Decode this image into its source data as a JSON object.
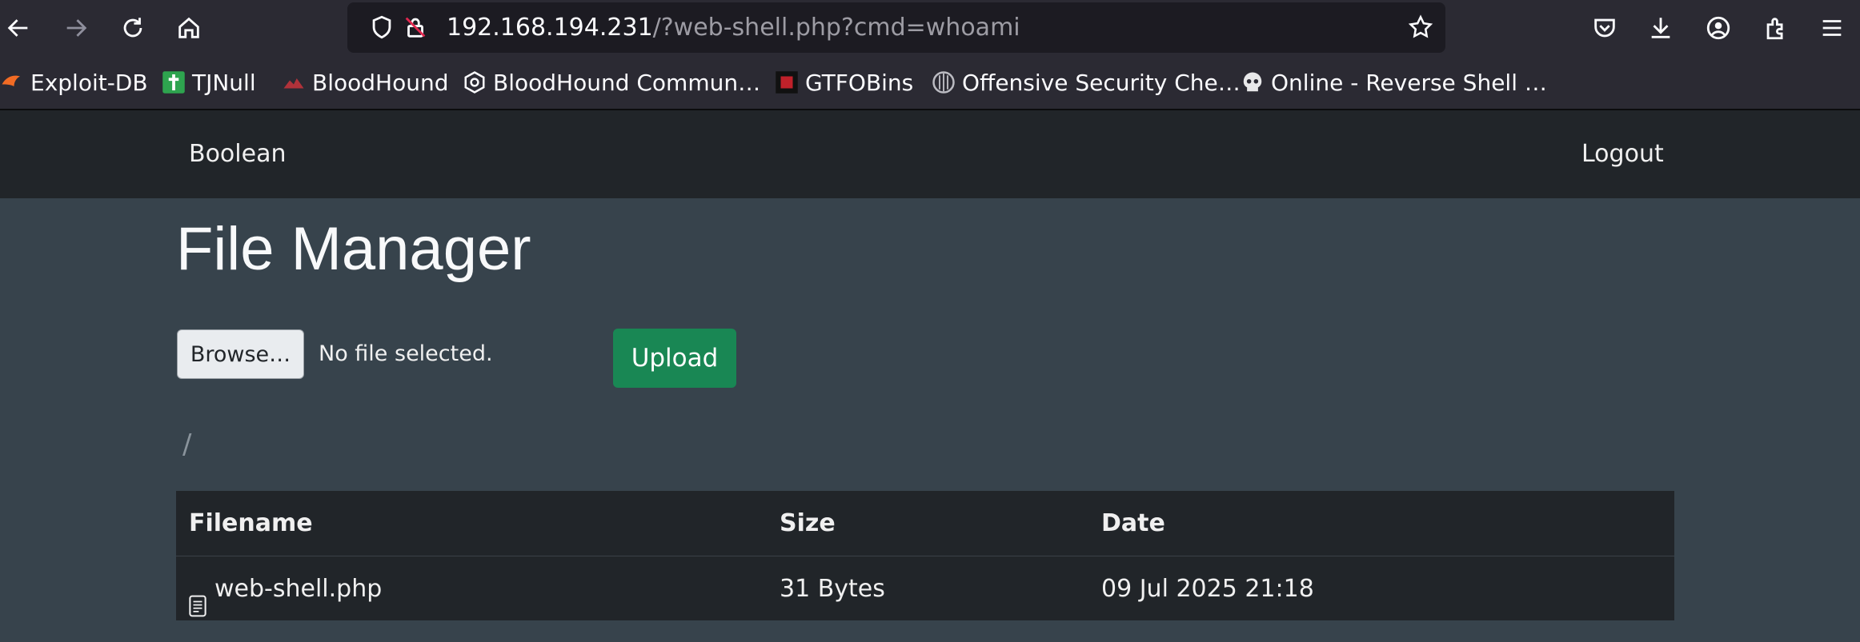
{
  "browser": {
    "url_host": "192.168.194.231",
    "url_path": "/?web-shell.php?cmd=whoami",
    "icons": [
      "back-icon",
      "forward-icon",
      "reload-icon",
      "home-icon",
      "shield-icon",
      "insecure-lock-icon",
      "bookmark-star-icon",
      "pocket-icon",
      "download-icon",
      "account-icon",
      "extensions-icon",
      "menu-icon"
    ]
  },
  "bookmarks": [
    {
      "label": "Exploit-DB"
    },
    {
      "label": "TJNull"
    },
    {
      "label": "BloodHound"
    },
    {
      "label": "BloodHound Commun…"
    },
    {
      "label": "GTFOBins"
    },
    {
      "label": "Offensive Security Che…"
    },
    {
      "label": "Online - Reverse Shell …"
    }
  ],
  "nav": {
    "brand": "Boolean",
    "logout": "Logout"
  },
  "page": {
    "title": "File Manager",
    "browse_label": "Browse…",
    "no_file_label": "No file selected.",
    "upload_label": "Upload",
    "breadcrumb": "/"
  },
  "table": {
    "headers": [
      "Filename",
      "Size",
      "Date"
    ],
    "rows": [
      {
        "filename": "web-shell.php",
        "size": "31 Bytes",
        "date": "09 Jul 2025 21:18"
      }
    ]
  },
  "colors": {
    "upload": "#198754",
    "navbar": "#212529",
    "page_bg": "#37434c"
  }
}
